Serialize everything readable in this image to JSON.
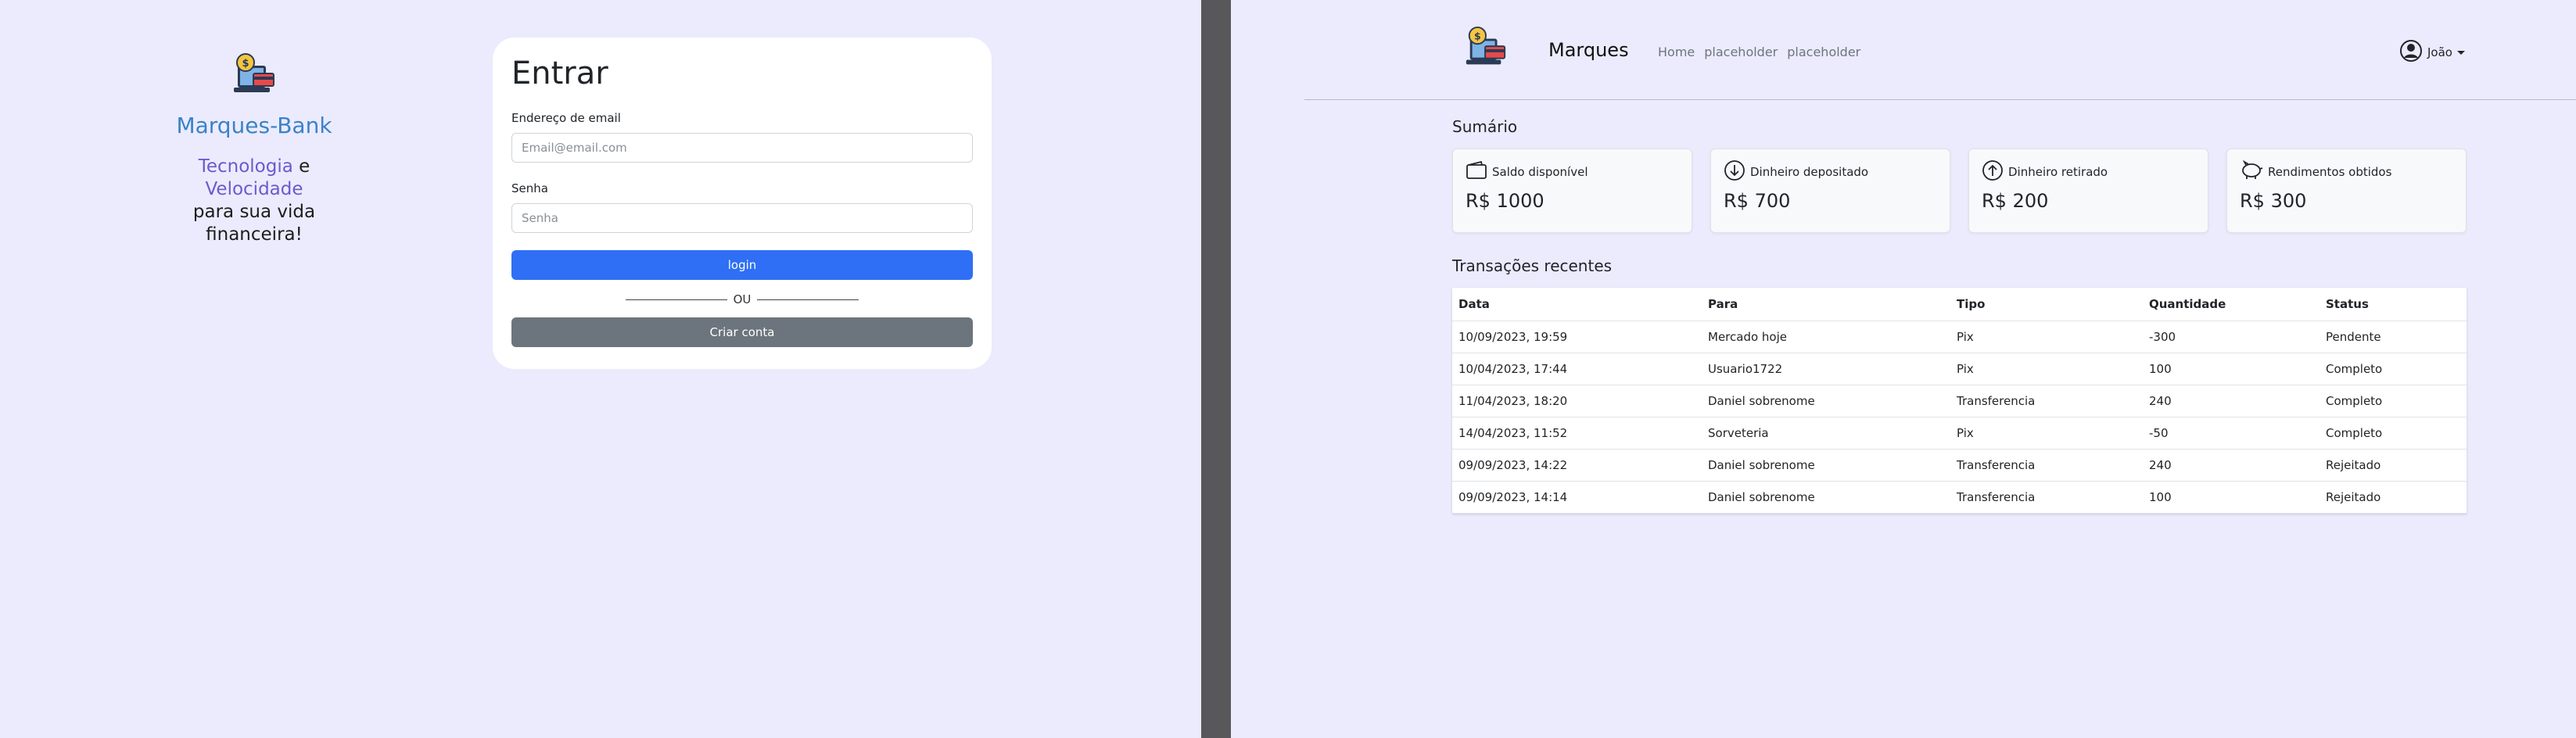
{
  "login": {
    "brand_name": "Marques-Bank",
    "tagline": {
      "word1": "Tecnologia",
      "conj": " e ",
      "word2": "Velocidade",
      "line2": "para sua vida financeira!"
    },
    "title": "Entrar",
    "email_label": "Endereço de email",
    "email_placeholder": "Email@email.com",
    "password_label": "Senha",
    "password_placeholder": "Senha",
    "login_button": "login",
    "divider_text": "OU",
    "create_button": "Criar conta"
  },
  "dashboard": {
    "brand": "Marques",
    "nav_links": [
      "Home",
      "placeholder",
      "placeholder"
    ],
    "user": "João",
    "summary_title": "Sumário",
    "cards": [
      {
        "icon": "wallet-icon",
        "label": "Saldo disponível",
        "value": "R$ 1000"
      },
      {
        "icon": "arrow-down-circle-icon",
        "label": "Dinheiro depositado",
        "value": "R$ 700"
      },
      {
        "icon": "arrow-up-circle-icon",
        "label": "Dinheiro retirado",
        "value": "R$ 200"
      },
      {
        "icon": "piggy-bank-icon",
        "label": "Rendimentos obtidos",
        "value": "R$ 300"
      }
    ],
    "recent_title": "Transações recentes",
    "table": {
      "headers": [
        "Data",
        "Para",
        "Tipo",
        "Quantidade",
        "Status"
      ],
      "rows": [
        [
          "10/09/2023, 19:59",
          "Mercado hoje",
          "Pix",
          "-300",
          "Pendente"
        ],
        [
          "10/04/2023, 17:44",
          "Usuario1722",
          "Pix",
          "100",
          "Completo"
        ],
        [
          "11/04/2023, 18:20",
          "Daniel sobrenome",
          "Transferencia",
          "240",
          "Completo"
        ],
        [
          "14/04/2023, 11:52",
          "Sorveteria",
          "Pix",
          "-50",
          "Completo"
        ],
        [
          "09/09/2023, 14:22",
          "Daniel sobrenome",
          "Transferencia",
          "240",
          "Rejeitado"
        ],
        [
          "09/09/2023, 14:14",
          "Daniel sobrenome",
          "Transferencia",
          "100",
          "Rejeitado"
        ]
      ]
    }
  },
  "colors": {
    "background": "#ebebfd",
    "primary": "#2f6ff5",
    "secondary": "#6c757d",
    "brand_text": "#3b82c9",
    "highlight": "#6a5acd",
    "splitter": "#58585a"
  }
}
